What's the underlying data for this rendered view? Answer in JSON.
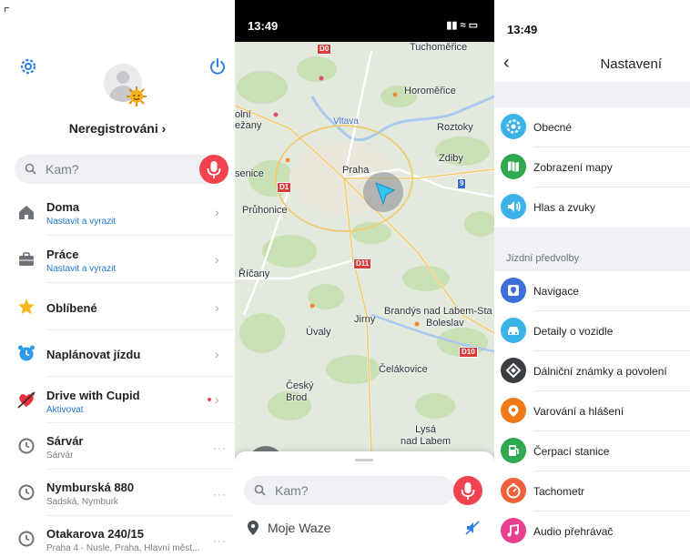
{
  "left_panel": {
    "username": "Neregistrováni ›",
    "search_placeholder": "Kam?",
    "items": [
      {
        "title": "Doma",
        "subtitle": "Nastavit a vyrazit",
        "icon": "home-icon"
      },
      {
        "title": "Práce",
        "subtitle": "Nastavit a vyrazit",
        "icon": "briefcase-icon"
      },
      {
        "title": "Oblíbené",
        "subtitle": "",
        "icon": "star-icon"
      },
      {
        "title": "Naplánovat jízdu",
        "subtitle": "",
        "icon": "alarm-clock-icon"
      },
      {
        "title": "Drive with Cupid",
        "subtitle": "Aktivovat",
        "icon": "heart-arrow-icon"
      },
      {
        "title": "Sárvár",
        "subtitle": "Sárvár",
        "icon": "history-icon"
      },
      {
        "title": "Nymburská 880",
        "subtitle": "Sadská, Nymburk",
        "icon": "history-icon"
      },
      {
        "title": "Otakarova 240/15",
        "subtitle": "Praha 4 - Nusle, Praha, Hlavní měst...",
        "icon": "history-icon"
      }
    ],
    "chevron": "›",
    "more": "···"
  },
  "map_panel": {
    "status_time": "13:49",
    "status_right": "▮▮ ≈ ▭",
    "labels": {
      "tuchomerice": "Tuchoměřice",
      "horomerice": "Horoměřice",
      "vltava": "Vltava",
      "roztoky": "Roztoky",
      "olni_zany": "olní\nežany",
      "zdiby": "Zdiby",
      "praha": "Praha",
      "senice": "senice",
      "pruhonice": "Průhonice",
      "ricany": "Říčany",
      "brandys": "Brandýs nad Labem-Sta",
      "boleslav": "Boleslav",
      "jirny": "Jirny",
      "uvaly": "Úvaly",
      "celakovice": "Čelákovice",
      "cesky_brod": "Český\nBrod",
      "lysa": "Lysá\nnad Labem"
    },
    "badges": {
      "d0": "D0",
      "d1": "D1",
      "d11": "D11",
      "d10": "D10",
      "n9": "9"
    },
    "search_placeholder": "Kam?",
    "my_waze": "Moje Waze"
  },
  "settings_panel": {
    "status_time": "13:49",
    "back": "‹",
    "title": "Nastavení",
    "section_driving": "Jízdní předvolby",
    "general_items": [
      {
        "label": "Obecné",
        "color": "#3bb3e8",
        "icon": "gear-icon"
      },
      {
        "label": "Zobrazení mapy",
        "color": "#2fa84f",
        "icon": "map-icon"
      },
      {
        "label": "Hlas a zvuky",
        "color": "#3bb3e8",
        "icon": "speaker-icon"
      }
    ],
    "driving_items": [
      {
        "label": "Navigace",
        "color": "#3c6fd8",
        "icon": "navigation-icon"
      },
      {
        "label": "Detaily o vozidle",
        "color": "#3bb3e8",
        "icon": "car-icon"
      },
      {
        "label": "Dálniční známky a povolení",
        "color": "#3a3d42",
        "icon": "diamond-icon"
      },
      {
        "label": "Varování a hlášení",
        "color": "#f07a1a",
        "icon": "alert-icon"
      },
      {
        "label": "Čerpací stanice",
        "color": "#2fa84f",
        "icon": "fuel-icon"
      },
      {
        "label": "Tachometr",
        "color": "#f0603a",
        "icon": "speedometer-icon"
      },
      {
        "label": "Audio přehrávač",
        "color": "#e8408f",
        "icon": "music-icon"
      }
    ]
  }
}
